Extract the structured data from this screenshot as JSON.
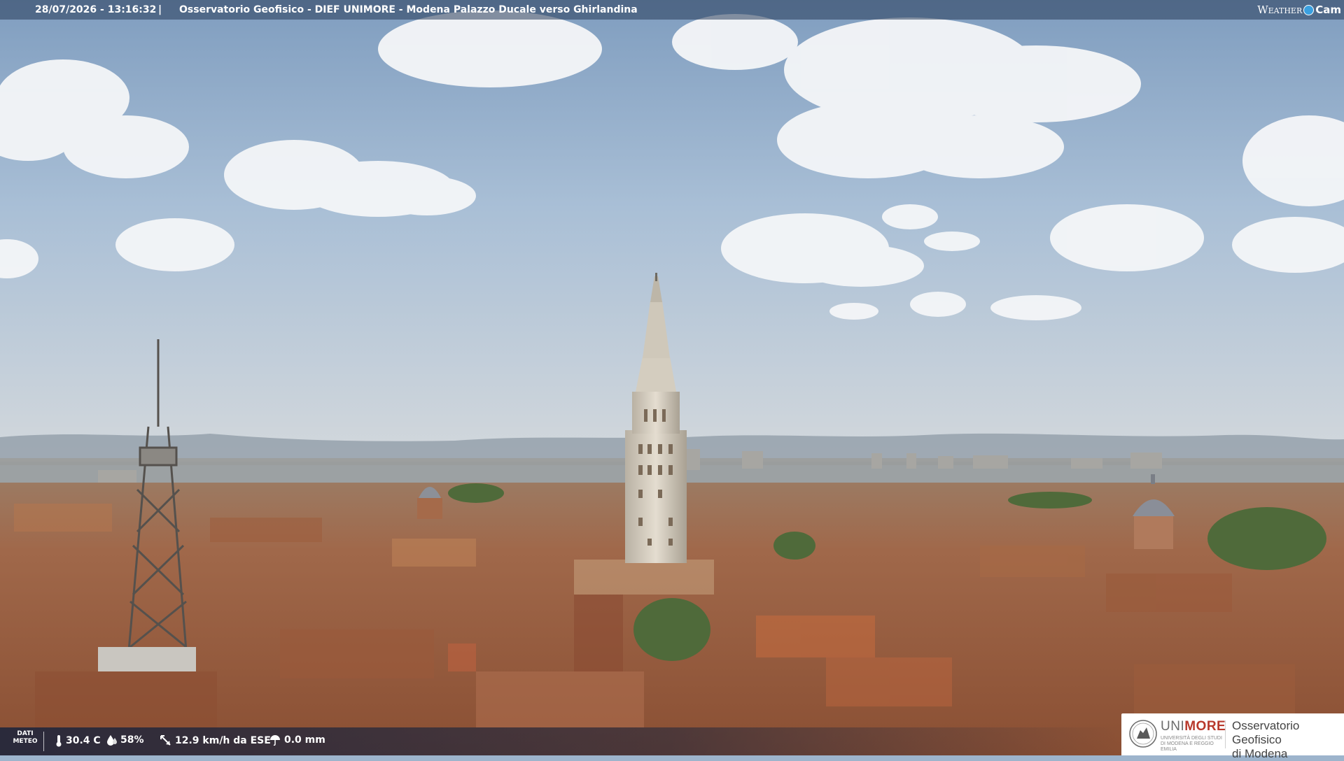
{
  "header": {
    "timestamp": "28/07/2026 - 13:16:32",
    "separator": "|",
    "title": "Osservatorio Geofisico - DIEF UNIMORE - Modena Palazzo Ducale verso Ghirlandina",
    "brand_weather": "Weather",
    "brand_cam": "Cam"
  },
  "weather": {
    "label_line1": "DATI",
    "label_line2": "METEO",
    "temperature": "30.4 C",
    "humidity": "58%",
    "wind": "12.9 km/h da ESE",
    "rain": "0.0 mm",
    "icons": [
      "thermometer-icon",
      "humidity-icon",
      "wind-icon",
      "rain-gauge-icon"
    ]
  },
  "logo": {
    "uni_prefix": "UNI",
    "uni_suffix": "MORE",
    "uni_subtitle": "UNIVERSITÀ DEGLI STUDI DI MODENA E REGGIO EMILIA",
    "observatory_line1": "Osservatorio Geofisico",
    "observatory_line2": "di Modena"
  },
  "colors": {
    "sky": "#9db8d3",
    "roof": "#a86a45",
    "tower": "#d9d2c4",
    "unimore_red": "#b8392c"
  }
}
